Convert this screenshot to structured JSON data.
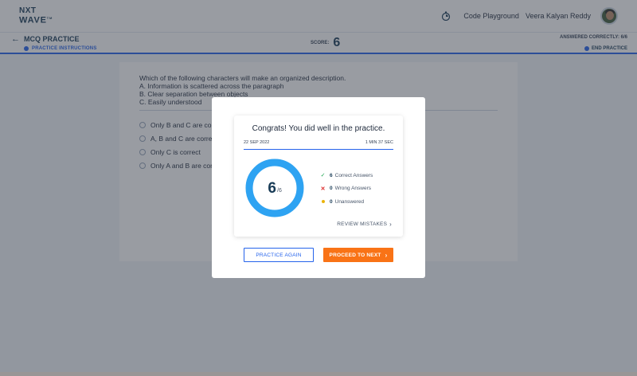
{
  "header": {
    "logo_line1": "NXT",
    "logo_line2": "WAVE",
    "logo_tm": "TM",
    "code_playground": "Code Playground",
    "user_name": "Veera Kalyan Reddy"
  },
  "subheader": {
    "back_title": "MCQ PRACTICE",
    "instructions": "PRACTICE INSTRUCTIONS",
    "score_label": "SCORE:",
    "score_value": "6",
    "answered_correctly": "ANSWERED CORRECTLY: 6/6",
    "end_practice": "END PRACTICE"
  },
  "question": {
    "lines": [
      "Which of the following characters will make an organized description.",
      "A. Information is scattered across the paragraph",
      "B. Clear separation between objects",
      "C. Easily understood"
    ],
    "options": [
      "Only B and C are correct",
      "A, B and C are correct",
      "Only C is correct",
      "Only A and B are correct"
    ]
  },
  "modal": {
    "congrats": "Congrats! You did well in the practice.",
    "date": "22 SEP 2022",
    "duration": "1 MIN 37 SEC",
    "score": "6",
    "total": "/6",
    "progress_fraction": 1.0,
    "ring_color": "#2ea3f2",
    "stats": [
      {
        "count": "6",
        "label": "Correct Answers",
        "icon": "check-icon",
        "color": "#16a34a"
      },
      {
        "count": "0",
        "label": "Wrong Answers",
        "icon": "cross-icon",
        "color": "#dc2626"
      },
      {
        "count": "0",
        "label": "Unanswered",
        "icon": "dot-icon",
        "color": "#eab308"
      }
    ],
    "review": "REVIEW MISTAKES",
    "practice_again": "PRACTICE AGAIN",
    "proceed": "PROCEED TO NEXT"
  },
  "colors": {
    "accent": "#2563eb",
    "orange": "#f97316",
    "navy": "#183b56"
  }
}
